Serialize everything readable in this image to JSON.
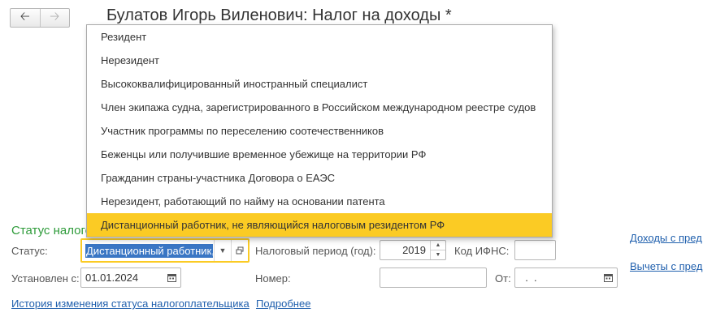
{
  "nav": {
    "back_icon": "arrow-left-icon",
    "forward_icon": "arrow-right-icon"
  },
  "window": {
    "title": "Булатов Игорь Виленович: Налог на доходы *"
  },
  "dropdown": {
    "options": [
      "Резидент",
      "Нерезидент",
      "Высококвалифицированный иностранный специалист",
      "Член экипажа судна, зарегистрированного в Российском международном реестре судов",
      "Участник программы по переселению соотечественников",
      "Беженцы или получившие временное убежище на территории РФ",
      "Гражданин страны-участника Договора о ЕАЭС",
      "Нерезидент, работающий по найму на основании патента",
      "Дистанционный работник, не являющийся налоговым резидентом РФ"
    ],
    "selected_index": 8
  },
  "section": {
    "title": "Статус налогоплательщика"
  },
  "form": {
    "status_label": "Статус:",
    "status_value": "Дистанционный работник,",
    "tax_period_label": "Налоговый период (год):",
    "tax_period_value": "2019",
    "ifns_label": "Код ИФНС:",
    "ifns_value": "",
    "established_label": "Установлен с:",
    "established_value": "01.01.2024",
    "number_label": "Номер:",
    "number_value": "",
    "from_label": "От:",
    "from_value": "  .  ."
  },
  "links": {
    "history": "История изменения статуса налогоплательщика",
    "more": "Подробнее",
    "income": "Доходы с пред",
    "deductions": "Вычеты с пред"
  },
  "colors": {
    "accent": "#fbcb24",
    "link": "#1f5fad",
    "section_title": "#2e9b3a",
    "selection": "#3a76c4"
  }
}
